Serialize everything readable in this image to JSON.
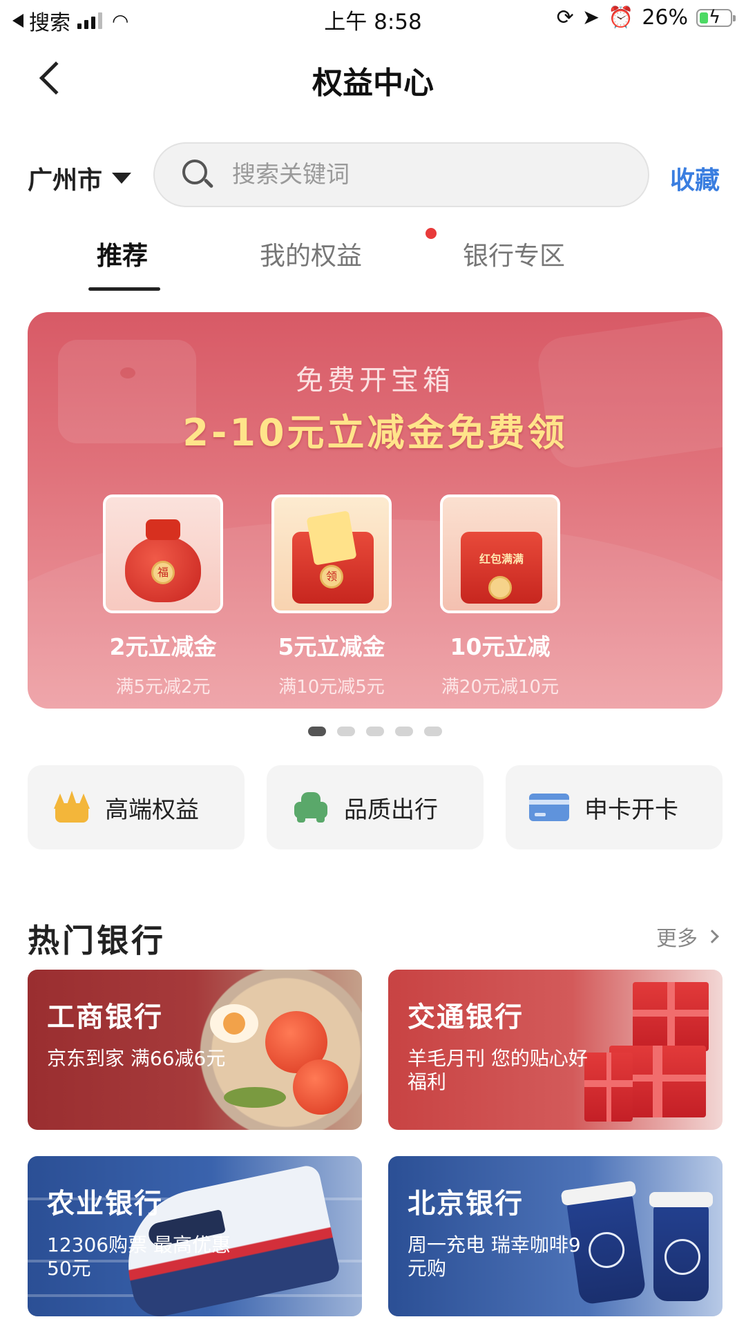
{
  "status_bar": {
    "back_app": "搜索",
    "time": "上午 8:58",
    "battery": "26%"
  },
  "header": {
    "title": "权益中心"
  },
  "search": {
    "city": "广州市",
    "placeholder": "搜索关键词",
    "favorite": "收藏"
  },
  "tabs": [
    {
      "label": "推荐",
      "active": true
    },
    {
      "label": "我的权益",
      "active": false,
      "has_dot": true
    },
    {
      "label": "银行专区",
      "active": false
    }
  ],
  "banner": {
    "subtitle": "免费开宝箱",
    "headline": "2-10元立减金免费领",
    "coupons": [
      {
        "name": "2元立减金",
        "condition": "满5元减2元",
        "image_text": "福"
      },
      {
        "name": "5元立减金",
        "condition": "满10元减5元",
        "image_text": "领"
      },
      {
        "name": "10元立减",
        "condition": "满20元减10元",
        "image_text": "红包满满"
      }
    ],
    "pager": {
      "count": 5,
      "active_index": 0
    }
  },
  "quick_entries": [
    {
      "label": "高端权益",
      "icon": "crown-icon",
      "icon_color": "#f3b63a"
    },
    {
      "label": "品质出行",
      "icon": "car-icon",
      "icon_color": "#5aa86a"
    },
    {
      "label": "申卡开卡",
      "icon": "card-icon",
      "icon_color": "#5f93dc"
    }
  ],
  "hot_banks": {
    "title": "热门银行",
    "more": "更多",
    "items": [
      {
        "name": "工商银行",
        "desc": "京东到家 满66减6元"
      },
      {
        "name": "交通银行",
        "desc": "羊毛月刊 您的贴心好福利"
      },
      {
        "name": "农业银行",
        "desc": "12306购票 最高优惠50元"
      },
      {
        "name": "北京银行",
        "desc": "周一充电 瑞幸咖啡9元购"
      }
    ]
  },
  "colors": {
    "accent_blue": "#3a7ee0",
    "banner_red": "#d85a66",
    "headline_gold": "#ffe48a",
    "notify_dot": "#e83a3a"
  }
}
